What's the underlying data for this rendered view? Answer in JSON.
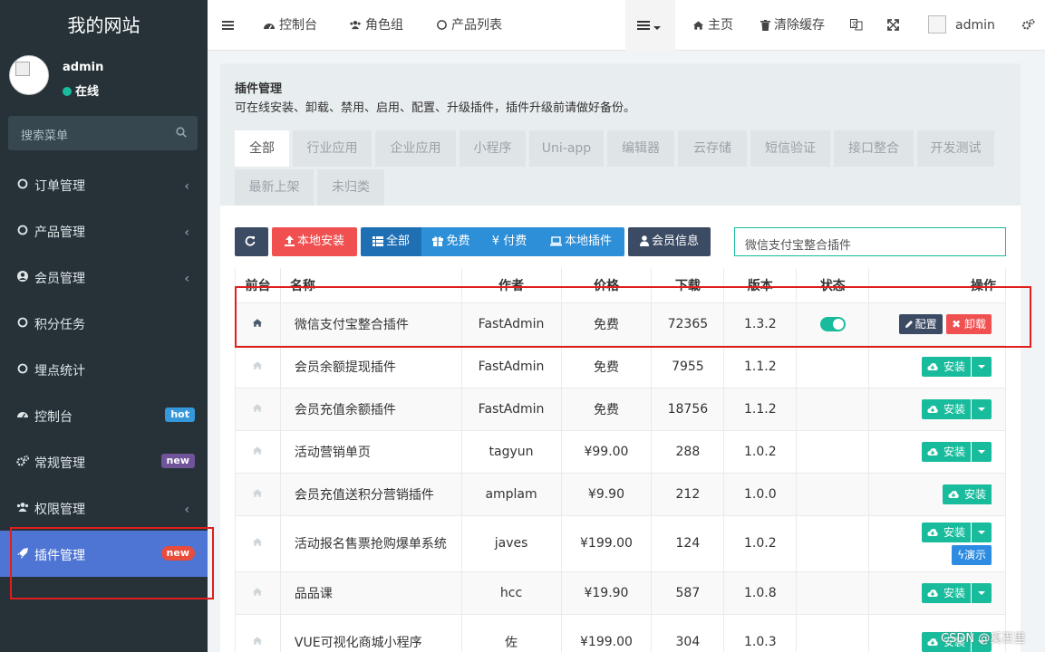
{
  "sidebar": {
    "brand": "我的网站",
    "user": {
      "name": "admin",
      "status": "在线"
    },
    "search_placeholder": "搜索菜单",
    "items": [
      {
        "label": "订单管理",
        "icon": "circle-icon",
        "has_arrow": true
      },
      {
        "label": "产品管理",
        "icon": "circle-icon",
        "has_arrow": true
      },
      {
        "label": "会员管理",
        "icon": "user-circle-icon",
        "has_arrow": true
      },
      {
        "label": "积分任务",
        "icon": "circle-icon",
        "has_arrow": false
      },
      {
        "label": "埋点统计",
        "icon": "circle-icon",
        "has_arrow": false
      },
      {
        "label": "控制台",
        "icon": "dashboard-icon",
        "badge": "hot"
      },
      {
        "label": "常规管理",
        "icon": "cogs-icon",
        "badge": "new"
      },
      {
        "label": "权限管理",
        "icon": "group-icon",
        "has_arrow": true
      },
      {
        "label": "插件管理",
        "icon": "rocket-icon",
        "badge": "new",
        "active": true
      }
    ]
  },
  "topbar": {
    "tabs": [
      "控制台",
      "角色组",
      "产品列表"
    ],
    "home": "主页",
    "clear_cache": "清除缓存",
    "user": "admin"
  },
  "panel": {
    "title": "插件管理",
    "description": "可在线安装、卸载、禁用、启用、配置、升级插件，插件升级前请做好备份。",
    "categories": [
      "全部",
      "行业应用",
      "企业应用",
      "小程序",
      "Uni-app",
      "编辑器",
      "云存储",
      "短信验证",
      "接口整合",
      "开发测试",
      "最新上架",
      "未归类"
    ]
  },
  "toolbar": {
    "local_install": "本地安装",
    "filter_all": "全部",
    "filter_free": "免费",
    "filter_paid": "付费",
    "filter_local": "本地插件",
    "member_info": "会员信息",
    "search_value": "微信支付宝整合插件"
  },
  "table": {
    "headers": [
      "前台",
      "名称",
      "作者",
      "价格",
      "下载",
      "版本",
      "状态",
      "操作"
    ],
    "rows": [
      {
        "name": "微信支付宝整合插件",
        "author": "FastAdmin",
        "price": "免费",
        "free": true,
        "downloads": "72365",
        "version": "1.3.2",
        "installed": true
      },
      {
        "name": "会员余额提现插件",
        "author": "FastAdmin",
        "price": "免费",
        "free": true,
        "downloads": "7955",
        "version": "1.1.2"
      },
      {
        "name": "会员充值余额插件",
        "author": "FastAdmin",
        "price": "免费",
        "free": true,
        "downloads": "18756",
        "version": "1.1.2"
      },
      {
        "name": "活动营销单页",
        "author": "tagyun",
        "price": "¥99.00",
        "downloads": "288",
        "version": "1.0.2"
      },
      {
        "name": "会员充值送积分营销插件",
        "author": "amplam",
        "price": "¥9.90",
        "downloads": "212",
        "version": "1.0.0",
        "no_dropdown": true
      },
      {
        "name": "活动报名售票抢购爆单系统",
        "author": "javes",
        "price": "¥199.00",
        "downloads": "124",
        "version": "1.0.2",
        "demo": true
      },
      {
        "name": "品品课",
        "author": "hcc",
        "price": "¥19.90",
        "downloads": "587",
        "version": "1.0.8"
      },
      {
        "name": "VUE可视化商城小程序",
        "author": "佐",
        "price": "¥199.00",
        "downloads": "304",
        "version": "1.0.3"
      }
    ],
    "config_label": "配置",
    "uninstall_label": "卸载",
    "install_label": "安装",
    "demo_label": "演示"
  },
  "watermark": "CSDN @奚百里",
  "colors": {
    "sidebar_bg": "#263238",
    "active": "#4e74d4",
    "accent_green": "#18bc9c",
    "price_red": "#e74c3c",
    "highlight": "#e01e1e"
  }
}
